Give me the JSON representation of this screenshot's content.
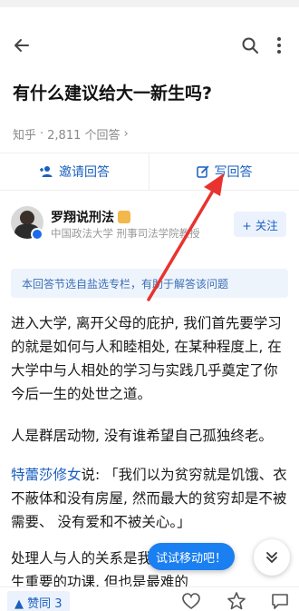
{
  "header": {
    "back_icon": "arrow-left-icon",
    "search_icon": "search-icon",
    "more_icon": "more-vertical-icon"
  },
  "question": {
    "title": "有什么建议给大一新生吗?",
    "source": "知乎",
    "sep": "·",
    "answer_count": "2,811 个回答",
    "chevron": "›"
  },
  "actions": {
    "invite_label": "邀请回答",
    "write_label": "写回答"
  },
  "author": {
    "name": "罗翔说刑法",
    "description": "中国政法大学 刑事司法学院教授",
    "follow_label": "+ 关注"
  },
  "notice": "本回答节选自盐选专栏，有助于解答该问题",
  "body": {
    "p1": "进入大学, 离开父母的庇护, 我们首先要学习的就是如何与人和睦相处, 在某种程度上, 在大学中与人相处的学习与实践几乎奠定了你今后一生的处世之道。",
    "p2": "人是群居动物, 没有谁希望自己孤独终老。",
    "p3_link": "特蕾莎修女",
    "p3_rest": "说: 「我们以为贫穷就是饥饿、衣不蔽体和没有房屋, 然而最大的贫穷却是不被需要、 没有爱和不被关心。」",
    "p4": "处理人与人的关系是我们一生重要的功课, 但也是最难的功课。"
  },
  "hint": "试试移动吧！",
  "bottom": {
    "vote_label": "▲ 赞同 3"
  },
  "colors": {
    "accent": "#1a5fbf",
    "arrow": "#e8332f",
    "hint_bg": "#1a7ff0"
  }
}
